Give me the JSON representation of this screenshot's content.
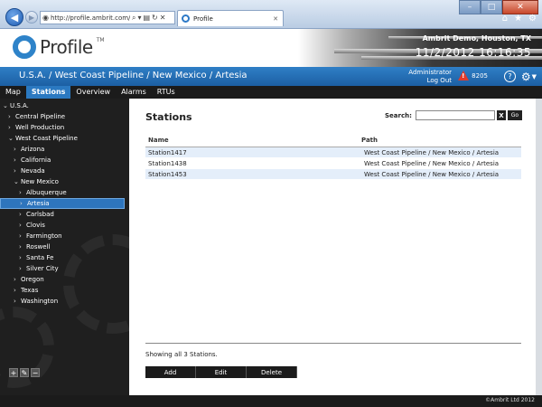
{
  "browser": {
    "url": "http://profile.ambrit.com/",
    "tab_title": "Profile",
    "tab_close": "✕",
    "win_minimize": "–",
    "win_maximize": "□",
    "win_close": "✕",
    "back": "◀",
    "forward": "▶",
    "addr_search": "⌕",
    "addr_dropdown": "▾",
    "addr_compat": "▤",
    "addr_refresh": "↻",
    "addr_stop": "✕",
    "home": "⌂",
    "favorites": "★",
    "tools": "⚙"
  },
  "header": {
    "logo_text": "Profile",
    "logo_tm": "TM",
    "company": "Ambrit Demo, Houston, TX",
    "date": "11/2/2012",
    "time": "16:16:35"
  },
  "crumbbar": {
    "breadcrumb": "U.S.A. / West Coast Pipeline / New Mexico / Artesia",
    "user": "Administrator",
    "logout": "Log Out",
    "alarm_count": "8205",
    "help": "?",
    "gear": "⚙",
    "caret": "▼"
  },
  "nav": {
    "tabs": [
      "Map",
      "Stations",
      "Overview",
      "Alarms",
      "RTUs"
    ],
    "active": "Stations"
  },
  "sidebar": {
    "tree": [
      {
        "label": "U.S.A.",
        "indent": 0,
        "open": true
      },
      {
        "label": "Central Pipeline",
        "indent": 1,
        "open": false
      },
      {
        "label": "Well Production",
        "indent": 1,
        "open": false
      },
      {
        "label": "West Coast Pipeline",
        "indent": 1,
        "open": true
      },
      {
        "label": "Arizona",
        "indent": 2,
        "open": false
      },
      {
        "label": "California",
        "indent": 2,
        "open": false
      },
      {
        "label": "Nevada",
        "indent": 2,
        "open": false
      },
      {
        "label": "New Mexico",
        "indent": 2,
        "open": true
      },
      {
        "label": "Albuquerque",
        "indent": 3,
        "open": false
      },
      {
        "label": "Artesia",
        "indent": 3,
        "open": false,
        "selected": true
      },
      {
        "label": "Carlsbad",
        "indent": 3,
        "open": false
      },
      {
        "label": "Clovis",
        "indent": 3,
        "open": false
      },
      {
        "label": "Farmington",
        "indent": 3,
        "open": false
      },
      {
        "label": "Roswell",
        "indent": 3,
        "open": false
      },
      {
        "label": "Santa Fe",
        "indent": 3,
        "open": false
      },
      {
        "label": "Silver City",
        "indent": 3,
        "open": false
      },
      {
        "label": "Oregon",
        "indent": 2,
        "open": false
      },
      {
        "label": "Texas",
        "indent": 2,
        "open": false
      },
      {
        "label": "Washington",
        "indent": 2,
        "open": false
      }
    ],
    "tool_add": "+",
    "tool_edit": "✎",
    "tool_remove": "−"
  },
  "main": {
    "title": "Stations",
    "search_label": "Search:",
    "search_value": "",
    "search_clear": "X",
    "search_go": "Go",
    "columns": [
      "Name",
      "Path"
    ],
    "rows": [
      {
        "name": "Station1417",
        "path": "West Coast Pipeline / New Mexico / Artesia"
      },
      {
        "name": "Station1438",
        "path": "West Coast Pipeline / New Mexico / Artesia"
      },
      {
        "name": "Station1453",
        "path": "West Coast Pipeline / New Mexico / Artesia"
      }
    ],
    "showing": "Showing all 3 Stations.",
    "actions": [
      "Add",
      "Edit",
      "Delete"
    ]
  },
  "footer": {
    "copyright": "©Ambrit Ltd 2012"
  },
  "colors": {
    "accent": "#2b79c1",
    "dark": "#1b1b1b",
    "row_alt": "#e4eefa",
    "alarm": "#e23a2a"
  }
}
